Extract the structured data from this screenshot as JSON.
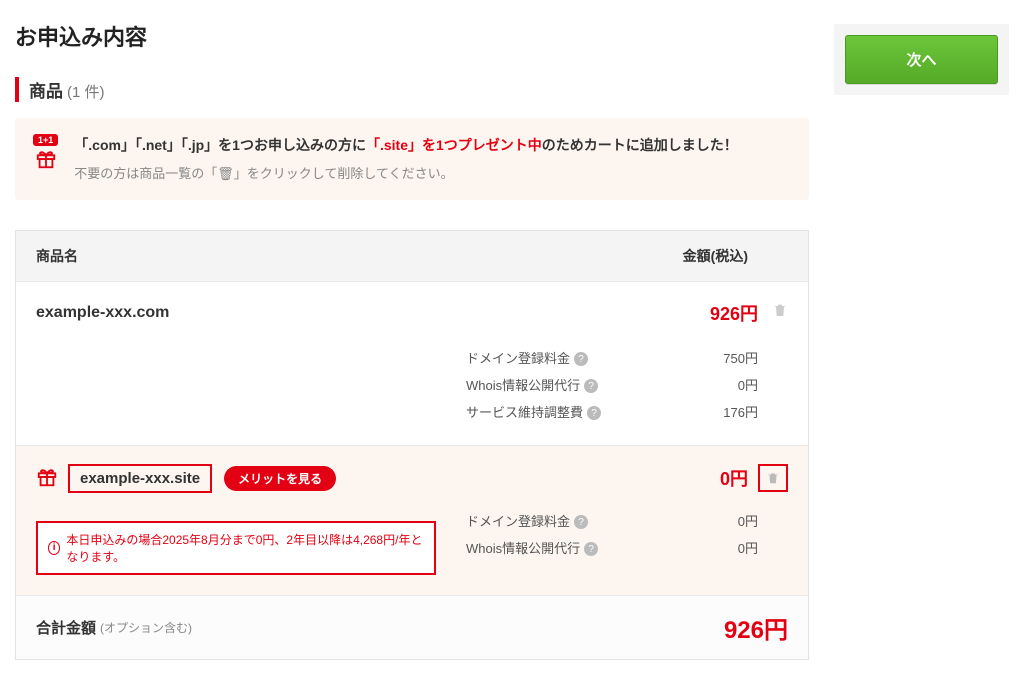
{
  "page_title": "お申込み内容",
  "section": {
    "label": "商品",
    "count": "(1 件)"
  },
  "promo": {
    "badge": "1+1",
    "line1_a": "「.com」「.net」「.jp」を1つお申し込みの方に",
    "line1_hl": "「.site」を1つプレゼント中",
    "line1_b": "のためカートに追加しました！",
    "line2": "不要の方は商品一覧の「🗑」をクリックして削除してください。"
  },
  "table": {
    "col_name": "商品名",
    "col_price": "金額(税込)"
  },
  "items": [
    {
      "name": "example-xxx.com",
      "total": "926円",
      "fees": [
        {
          "label": "ドメイン登録料金",
          "amount": "750円"
        },
        {
          "label": "Whois情報公開代行",
          "amount": "0円"
        },
        {
          "label": "サービス維持調整費",
          "amount": "176円"
        }
      ]
    }
  ],
  "bonus": {
    "name": "example-xxx.site",
    "merit_btn": "メリットを見る",
    "total": "0円",
    "notice": "本日申込みの場合2025年8月分まで0円、2年目以降は4,268円/年となります。",
    "fees": [
      {
        "label": "ドメイン登録料金",
        "amount": "0円"
      },
      {
        "label": "Whois情報公開代行",
        "amount": "0円"
      }
    ]
  },
  "summary": {
    "label": "合計金額",
    "note": "(オプション含む)",
    "amount": "926円"
  },
  "next_button": "次へ"
}
